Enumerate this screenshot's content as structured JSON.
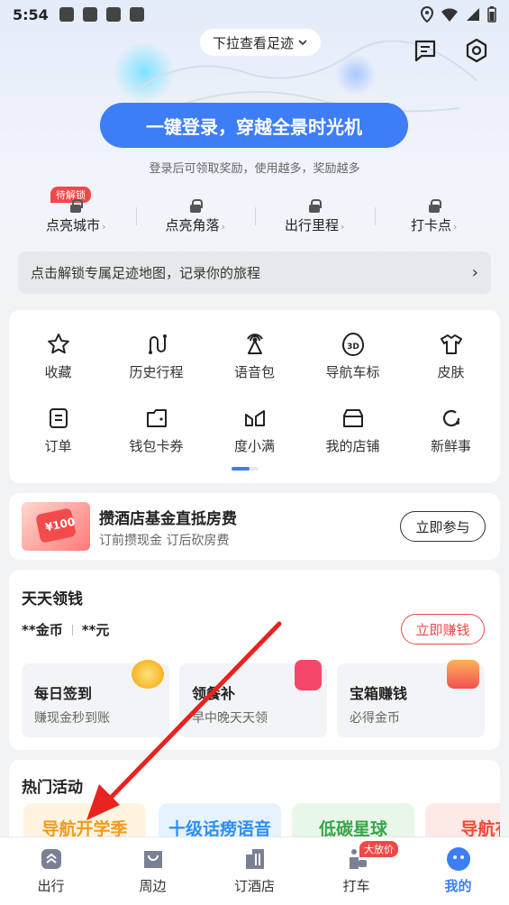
{
  "status_bar": {
    "time": "5:54"
  },
  "header": {
    "pulldown": "下拉查看足迹",
    "login_button": "一键登录，穿越全景时光机",
    "login_subtitle": "登录后可领取奖励，使用越多，奖励越多"
  },
  "stats": [
    {
      "label": "点亮城市",
      "badge": "待解锁"
    },
    {
      "label": "点亮角落"
    },
    {
      "label": "出行里程"
    },
    {
      "label": "打卡点"
    }
  ],
  "unlock_bar": {
    "text": "点击解锁专属足迹地图，记录你的旅程"
  },
  "grid": [
    {
      "label": "收藏",
      "icon": "star-icon"
    },
    {
      "label": "历史行程",
      "icon": "route-icon"
    },
    {
      "label": "语音包",
      "icon": "voice-icon"
    },
    {
      "label": "导航车标",
      "icon": "3d-icon"
    },
    {
      "label": "皮肤",
      "icon": "tshirt-icon"
    },
    {
      "label": "订单",
      "icon": "order-icon"
    },
    {
      "label": "钱包卡券",
      "icon": "wallet-icon"
    },
    {
      "label": "度小满",
      "icon": "duxiaoman-icon"
    },
    {
      "label": "我的店铺",
      "icon": "store-icon"
    },
    {
      "label": "新鲜事",
      "icon": "refresh-icon"
    }
  ],
  "hotel": {
    "title": "攒酒店基金直抵房费",
    "subtitle": "订前攒现金  订后砍房费",
    "button": "立即参与",
    "image_text": "¥100"
  },
  "money": {
    "title": "天天领钱",
    "coins": "**金币",
    "cash": "**元",
    "button": "立即赚钱",
    "cards": [
      {
        "title": "每日签到",
        "subtitle": "赚现金秒到账"
      },
      {
        "title": "领餐补",
        "subtitle": "早中晚天天领"
      },
      {
        "title": "宝箱赚钱",
        "subtitle": "必得金币"
      }
    ]
  },
  "activities": {
    "title": "热门活动",
    "items": [
      "导航开学季",
      "十级话痨语音",
      "低碳星球",
      "导航有"
    ]
  },
  "tabbar": [
    {
      "label": "出行"
    },
    {
      "label": "周边"
    },
    {
      "label": "订酒店"
    },
    {
      "label": "打车",
      "badge": "大放价"
    },
    {
      "label": "我的",
      "active": true
    }
  ],
  "colors": {
    "accent": "#3d7df5",
    "red": "#f04848"
  }
}
